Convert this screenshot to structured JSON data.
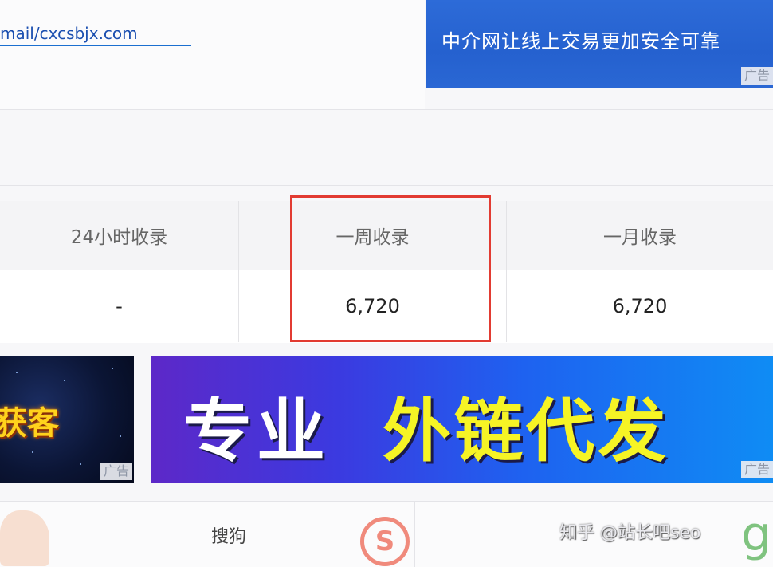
{
  "header": {
    "email_text": "mail/cxcsbjx.com"
  },
  "top_ad": {
    "text": "中介网让线上交易更加安全可靠",
    "ad_label": "广告"
  },
  "stats": {
    "headers": [
      "24小时收录",
      "一周收录",
      "一月收录"
    ],
    "values": [
      "-",
      "6,720",
      "6,720"
    ]
  },
  "banner_left": {
    "text": "获客",
    "ad_label": "广告"
  },
  "banner_right": {
    "text_white": "专业",
    "text_yellow": "外链代发",
    "ad_label": "广告"
  },
  "bottom": {
    "sogou_label": "搜狗",
    "sogou_logo_letter": "S",
    "watermark": "知乎 @站长吧seo",
    "gplus_glyph": "g+"
  },
  "colors": {
    "highlight": "#e23b32",
    "link": "#1b4fb0",
    "ad_blue": "#2561cf",
    "banner_yellow": "#f6f425"
  }
}
